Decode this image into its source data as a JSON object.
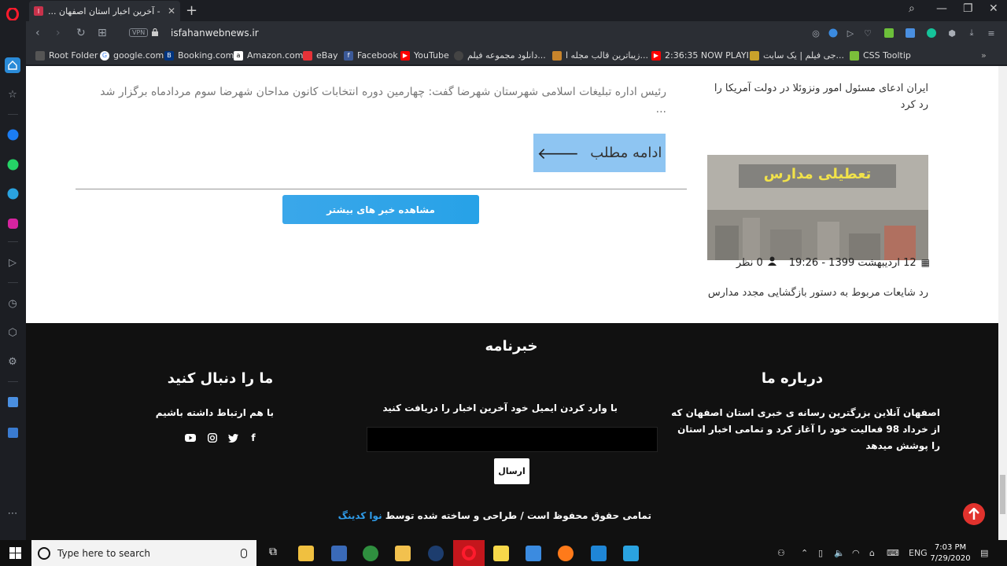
{
  "browser": {
    "tab_title": "- آخرین اخبار استان اصفهان ...",
    "url": "isfahanwebnews.ir",
    "vpn_label": "VPN"
  },
  "bookmarks": [
    {
      "label": "Root Folder",
      "color": "#333333"
    },
    {
      "label": "google.com",
      "color": "#4285f4"
    },
    {
      "label": "Booking.com",
      "color": "#003580"
    },
    {
      "label": "Amazon.com",
      "color": "#222222"
    },
    {
      "label": "eBay",
      "color": "#e53238"
    },
    {
      "label": "Facebook",
      "color": "#3b5998"
    },
    {
      "label": "YouTube",
      "color": "#ff0000"
    },
    {
      "label": "دانلود مجموعه فیلم...",
      "color": "#444444"
    },
    {
      "label": "زیباترین قالب مجله ا...",
      "color": "#c8842b"
    },
    {
      "label": "2:36:35 NOW PLAYI...",
      "color": "#ff0000"
    },
    {
      "label": "جی فیلم | یک سایت...",
      "color": "#c8a22b"
    },
    {
      "label": "CSS Tooltip",
      "color": "#7bbf3a"
    }
  ],
  "article": {
    "summary": "رئیس اداره تبلیغات اسلامی شهرستان شهرضا گفت: چهارمین دوره انتخابات کانون مداحان شهرضا سوم مردادماه برگزار شد ...",
    "read_more": "ادامه مطلب",
    "more_news_button": "مشاهده خبر های بیشتر"
  },
  "sidebar_news": {
    "headline": "ایران ادعای مسئول امور ونزوئلا در دولت آمریکا را رد کرد",
    "image_caption_text": "تعطیلی مدارس",
    "date": "12 اردیبهشت 1399 - 19:26",
    "comments": "0 نظر",
    "caption": "رد شایعات مربوط به دستور بازگشایی مجدد مدارس"
  },
  "footer": {
    "newsletter_title": "خبرنامه",
    "about_title": "درباره ما",
    "about_text": "اصفهان آنلاین بزرگترین رسانه ی خبری استان اصفهان که از خرداد 98 فعالیت خود را آغاز کرد و تمامی اخبار استان را پوشش میدهد",
    "newsletter_text": "با وارد کردن ایمیل خود آخرین اخبار را دریافت کنید",
    "send_button": "ارسال",
    "follow_title": "ما را دنبال کنید",
    "follow_text": "با هم ارتباط داشته باشیم",
    "copyright_text": "تمامی حقوق محفوظ است / طراحی و ساخته شده توسط",
    "copyright_brand": "نوا کدینگ"
  },
  "taskbar": {
    "search_placeholder": "Type here to search",
    "language": "ENG",
    "time": "7:03 PM",
    "date": "7/29/2020"
  },
  "colors": {
    "read_more_bg": "#8ec5f2",
    "more_news_bg": "#2ba3e8",
    "footer_bg": "#111111",
    "to_top_bg": "#e1322d",
    "brand_link": "#2f9be8"
  }
}
